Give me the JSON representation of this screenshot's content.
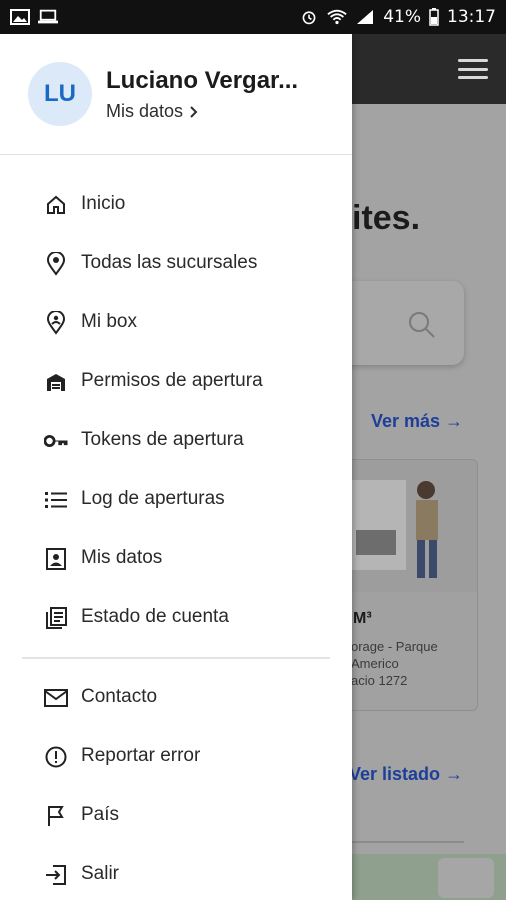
{
  "status_bar": {
    "battery": "41%",
    "time": "13:17"
  },
  "profile": {
    "initials": "LU",
    "name": "Luciano Vergar...",
    "my_data_link": "Mis datos"
  },
  "menu": {
    "items": [
      {
        "label": "Inicio",
        "icon": "home-icon"
      },
      {
        "label": "Todas las sucursales",
        "icon": "location-pin-icon"
      },
      {
        "label": "Mi box",
        "icon": "user-pin-icon"
      },
      {
        "label": "Permisos de apertura",
        "icon": "garage-icon"
      },
      {
        "label": "Tokens de apertura",
        "icon": "key-icon"
      },
      {
        "label": "Log de aperturas",
        "icon": "list-icon"
      },
      {
        "label": "Mis datos",
        "icon": "id-card-icon"
      },
      {
        "label": "Estado de cuenta",
        "icon": "document-stack-icon"
      }
    ],
    "secondary_items": [
      {
        "label": "Contacto",
        "icon": "mail-icon"
      },
      {
        "label": "Reportar error",
        "icon": "alert-icon"
      },
      {
        "label": "País",
        "icon": "flag-icon"
      },
      {
        "label": "Salir",
        "icon": "logout-icon"
      }
    ]
  },
  "background": {
    "heading_fragment": "ites.",
    "ver_mas_link": "Ver más →",
    "card_title": "M³",
    "card_lines": [
      "orage - Parque",
      "Americo",
      "acio 1272"
    ],
    "ver_listado_link": "Ver listado →"
  },
  "colors": {
    "accent": "#1b69c4",
    "avatar_bg": "#dbe9f8",
    "link_blue": "#1d3f9a"
  }
}
